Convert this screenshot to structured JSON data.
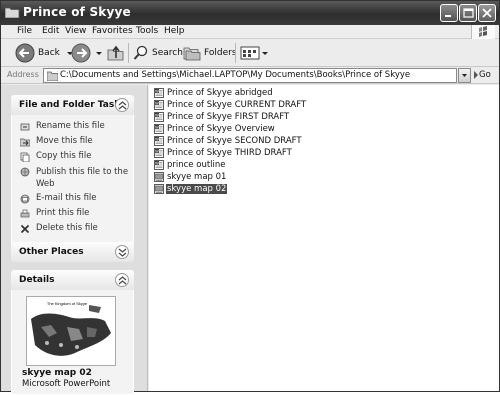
{
  "window": {
    "title": "Prince of Skyye"
  },
  "menu": {
    "items": [
      "File",
      "Edit",
      "View",
      "Favorites",
      "Tools",
      "Help"
    ]
  },
  "toolbar": {
    "back_label": "Back",
    "search_label": "Search",
    "folders_label": "Folders"
  },
  "address": {
    "label": "Address",
    "path": "C:\\Documents and Settings\\Michael.LAPTOP\\My Documents\\Books\\Prince of Skyye",
    "go_label": "Go"
  },
  "tasks_panel": {
    "title": "File and Folder Tasks",
    "items": [
      {
        "label": "Rename this file",
        "icon": "rename-icon"
      },
      {
        "label": "Move this file",
        "icon": "move-icon"
      },
      {
        "label": "Copy this file",
        "icon": "copy-icon"
      },
      {
        "label": "Publish this file to the Web",
        "icon": "publish-web-icon"
      },
      {
        "label": "E-mail this file",
        "icon": "email-icon"
      },
      {
        "label": "Print this file",
        "icon": "print-icon"
      },
      {
        "label": "Delete this file",
        "icon": "delete-icon"
      }
    ]
  },
  "other_places": {
    "title": "Other Places"
  },
  "details": {
    "title": "Details",
    "thumbnail_caption": "The Kingdom of Skyye",
    "file_name": "skyye map 02",
    "file_type": "Microsoft PowerPoint"
  },
  "files": [
    {
      "name": "Prince of Skyye abridged",
      "type": "word-document-icon",
      "selected": false
    },
    {
      "name": "Prince of Skyye CURRENT DRAFT",
      "type": "word-document-icon",
      "selected": false
    },
    {
      "name": "Prince of Skyye FIRST DRAFT",
      "type": "word-document-icon",
      "selected": false
    },
    {
      "name": "Prince of Skyye Overview",
      "type": "word-document-icon",
      "selected": false
    },
    {
      "name": "Prince of Skyye SECOND DRAFT",
      "type": "word-document-icon",
      "selected": false
    },
    {
      "name": "Prince of Skyye THIRD DRAFT",
      "type": "word-document-icon",
      "selected": false
    },
    {
      "name": "prince outline",
      "type": "word-document-icon",
      "selected": false
    },
    {
      "name": "skyye map 01",
      "type": "powerpoint-icon",
      "selected": false
    },
    {
      "name": "skyye map 02",
      "type": "powerpoint-icon",
      "selected": true
    }
  ]
}
